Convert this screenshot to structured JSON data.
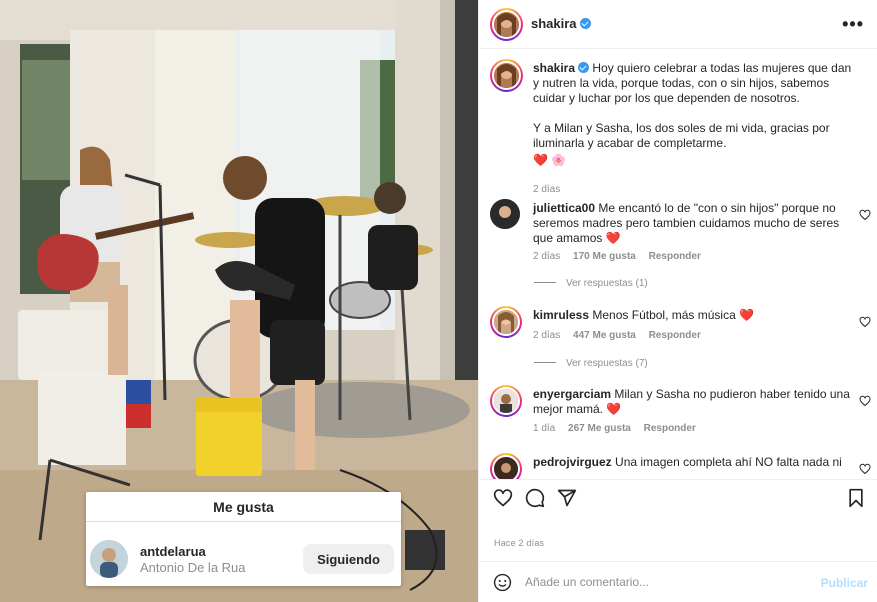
{
  "post": {
    "username": "shakira",
    "header_more": "•••",
    "caption_p1": "Hoy quiero celebrar a todas las mujeres que dan y nutren la vida, porque todas, con o sin hijos, sabemos cuidar y luchar por los que dependen de nosotros.",
    "caption_p2": "Y a Milan y Sasha, los dos soles de mi vida, gracias por iluminarla y acabar de completarme.",
    "caption_emojis": "❤️ 🌸",
    "caption_time": "2 días",
    "date": "Hace 2 días"
  },
  "comments": [
    {
      "user": "juliettica00",
      "text": "Me encantó lo de \"con o sin hijos\" porque no seremos madres pero tambien cuidamos mucho de seres que amamos",
      "emoji": "❤️",
      "time": "2 días",
      "likes": "170 Me gusta",
      "reply": "Responder",
      "view_replies": "Ver respuestas (1)"
    },
    {
      "user": "kimruless",
      "text": "Menos Fútbol, más música",
      "emoji": "❤️",
      "time": "2 días",
      "likes": "447 Me gusta",
      "reply": "Responder",
      "view_replies": "Ver respuestas (7)"
    },
    {
      "user": "enyergarciam",
      "text": "Milan y Sasha no pudieron haber tenido una mejor mamá.",
      "emoji": "❤️",
      "time": "1 día",
      "likes": "267 Me gusta",
      "reply": "Responder"
    },
    {
      "user": "pedrojvirguez",
      "text": "Una imagen completa ahí NO falta nada ni"
    }
  ],
  "likes_popup": {
    "title": "Me gusta",
    "username": "antdelarua",
    "full_name": "Antonio De la Rua",
    "button": "Siguiendo"
  },
  "add_comment": {
    "placeholder": "Añade un comentario...",
    "publish": "Publicar"
  },
  "icons": [
    "heart-icon",
    "comment-icon",
    "share-icon",
    "bookmark-icon",
    "emoji-icon",
    "more-icon",
    "verified-icon"
  ],
  "colors": {
    "accent": "#0095f6",
    "publish_disabled": "#b2dffc",
    "heart_red": "#ed4956",
    "text": "#262626",
    "muted": "#8e8e8e"
  }
}
